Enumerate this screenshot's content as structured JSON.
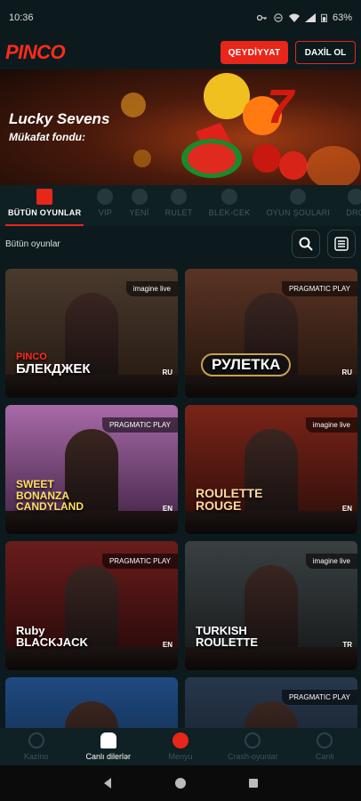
{
  "status_bar": {
    "time": "10:36",
    "battery": "63%"
  },
  "header": {
    "logo": "PINCO",
    "register_label": "QEYDİYYAT",
    "login_label": "DAXİL OL"
  },
  "banner": {
    "title": "Lucky Sevens",
    "subtitle": "Mükafat fondu:"
  },
  "categories": [
    {
      "label": "BÜTÜN OYUNLAR",
      "icon": "grid-icon",
      "active": true
    },
    {
      "label": "VIP",
      "icon": "gear-chip-icon"
    },
    {
      "label": "YENİ",
      "icon": "new-badge-icon"
    },
    {
      "label": "RULET",
      "icon": "roulette-icon"
    },
    {
      "label": "BLEK-CEK",
      "icon": "cards-icon"
    },
    {
      "label": "OYUN ŞOULARI",
      "icon": "wheel-icon"
    },
    {
      "label": "DRO",
      "icon": "drop-icon"
    }
  ],
  "filter": {
    "label": "Bütün oyunlar",
    "search_icon": "search-icon",
    "filter_icon": "list-icon"
  },
  "games": [
    {
      "title": "БЛЕКДЖЕК",
      "brand": "PINCO",
      "provider": "imagine live",
      "lang": "RU",
      "bg": "#3a2a20"
    },
    {
      "title": "РУЛЕТКА",
      "provider": "PRAGMATIC PLAY",
      "lang": "RU",
      "bg": "#3d2418"
    },
    {
      "title": "SWEET BONANZA CANDYLAND",
      "provider": "PRAGMATIC PLAY",
      "lang": "EN",
      "bg": "#7a4a7a"
    },
    {
      "title": "ROULETTE ROUGE",
      "provider": "imagine live",
      "lang": "EN",
      "bg": "#5a1a14"
    },
    {
      "title": "Ruby BLACKJACK",
      "provider": "PRAGMATIC PLAY",
      "lang": "EN",
      "bg": "#4a1616"
    },
    {
      "title": "TURKISH ROULETTE",
      "provider": "imagine live",
      "lang": "TR",
      "bg": "#2a2e30"
    },
    {
      "title": "",
      "provider": "",
      "lang": "",
      "bg": "#16345a"
    },
    {
      "title": "",
      "provider": "PRAGMATIC PLAY",
      "lang": "",
      "bg": "#1e2a38"
    }
  ],
  "bottom_nav": [
    {
      "label": "Kazino",
      "icon": "casino-chip-icon"
    },
    {
      "label": "Canlı dilerlər",
      "icon": "dealer-icon",
      "active": true
    },
    {
      "label": "Menyu",
      "icon": "target-icon",
      "menu": true
    },
    {
      "label": "Crash-oyunlar",
      "icon": "rocket-icon"
    },
    {
      "label": "Canlı",
      "icon": "live-icon"
    }
  ],
  "colors": {
    "accent": "#e8261a",
    "background": "#0d1a1d"
  }
}
